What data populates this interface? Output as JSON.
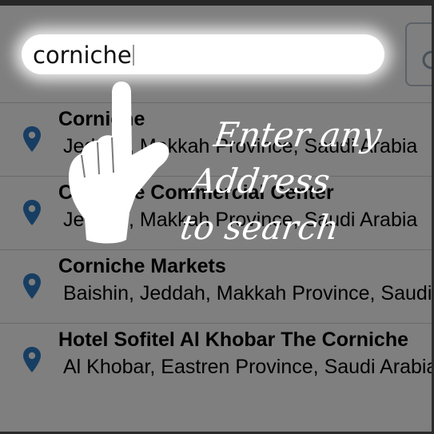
{
  "search": {
    "value": "corniche"
  },
  "results": [
    {
      "title": "Corniche",
      "subtitle": "Jeddah, Makkah Province, Saudi Arabia"
    },
    {
      "title": "Corniche Commercial Center",
      "subtitle": "Jeddah, Makkah Province, Saudi Arabia"
    },
    {
      "title": "Corniche Markets",
      "subtitle": "Baishin, Jeddah, Makkah Province, Saudi Arabia"
    },
    {
      "title": "Hotel Sofitel Al Khobar The Corniche",
      "subtitle": "Al Khobar, Eastren Province, Saudi Arabia"
    }
  ],
  "hint": {
    "line1": "Enter any",
    "line2": "Address",
    "line3": "to search"
  },
  "icons": {
    "result_icon": "map-pin-icon",
    "locate_icon": "locate-icon",
    "hand_icon": "pointing-hand-icon"
  },
  "colors": {
    "overlay": "#000000",
    "pin": "#2e7dc4",
    "hint_text": "#ffffff"
  }
}
